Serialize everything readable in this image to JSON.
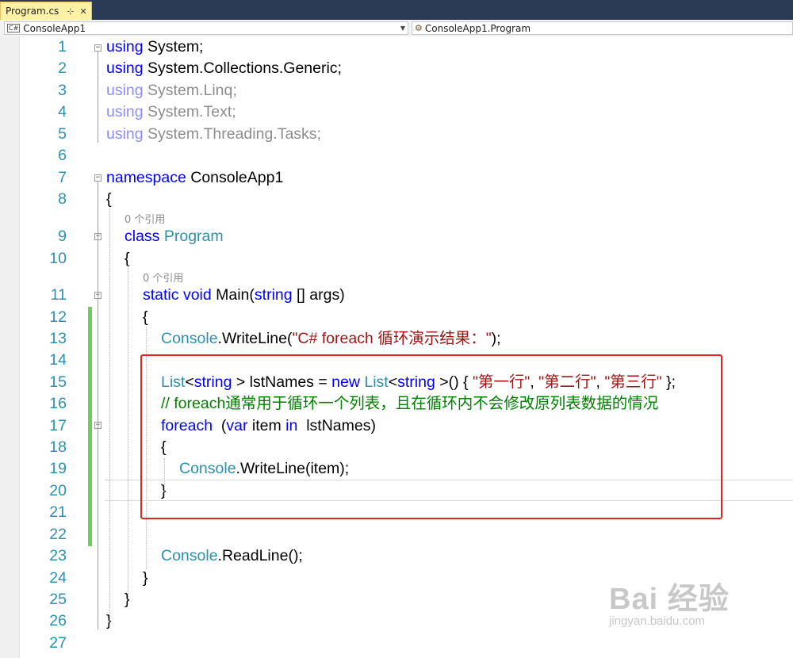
{
  "tab": {
    "title": "Program.cs",
    "pin_glyph": "⊹",
    "close_glyph": "✕"
  },
  "nav": {
    "project": "ConsoleApp1",
    "member": "ConsoleApp1.Program"
  },
  "refs": {
    "class_refs": "0 个引用",
    "method_refs": "0 个引用"
  },
  "lines": [
    {
      "n": "1",
      "segs": [
        [
          "kw",
          "using"
        ],
        [
          "",
          "System;"
        ]
      ]
    },
    {
      "n": "2",
      "segs": [
        [
          "kw",
          "using"
        ],
        [
          "",
          "System.Collections.Generic;"
        ]
      ]
    },
    {
      "n": "3",
      "dim": true,
      "segs": [
        [
          "kw",
          "using"
        ],
        [
          "",
          "System.Linq;"
        ]
      ]
    },
    {
      "n": "4",
      "dim": true,
      "segs": [
        [
          "kw",
          "using"
        ],
        [
          "",
          "System.Text;"
        ]
      ]
    },
    {
      "n": "5",
      "dim": true,
      "segs": [
        [
          "kw",
          "using"
        ],
        [
          "",
          "System.Threading.Tasks;"
        ]
      ]
    },
    {
      "n": "6",
      "segs": []
    },
    {
      "n": "7",
      "segs": [
        [
          "kw",
          "namespace"
        ],
        [
          "",
          "ConsoleApp1"
        ]
      ]
    },
    {
      "n": "8",
      "segs": [
        [
          "",
          "{"
        ]
      ]
    },
    {
      "n": "9",
      "segs": [
        [
          "kw",
          "class"
        ],
        [
          "ty",
          "Program"
        ]
      ]
    },
    {
      "n": "10",
      "segs": [
        [
          "",
          "{"
        ]
      ]
    },
    {
      "n": "11",
      "segs": [
        [
          "kw",
          "static"
        ],
        [
          "kw",
          "void"
        ],
        [
          "",
          "Main("
        ],
        [
          "kw",
          "string"
        ],
        [
          "",
          "[] args)"
        ]
      ]
    },
    {
      "n": "12",
      "segs": [
        [
          "",
          "{"
        ]
      ]
    },
    {
      "n": "13",
      "segs": [
        [
          "ty",
          "Console"
        ],
        [
          "",
          ".WriteLine("
        ],
        [
          "str",
          "\"C# foreach 循环演示结果：\""
        ],
        [
          "",
          ");"
        ]
      ]
    },
    {
      "n": "14",
      "segs": []
    },
    {
      "n": "15",
      "segs": [
        [
          "ty",
          "List"
        ],
        [
          "",
          "<"
        ],
        [
          "kw",
          "string"
        ],
        [
          "",
          "> lstNames = "
        ],
        [
          "kw",
          "new"
        ],
        [
          "ty",
          "List"
        ],
        [
          "",
          "<"
        ],
        [
          "kw",
          "string"
        ],
        [
          "",
          ">() { "
        ],
        [
          "str",
          "\"第一行\""
        ],
        [
          "",
          ", "
        ],
        [
          "str",
          "\"第二行\""
        ],
        [
          "",
          ", "
        ],
        [
          "str",
          "\"第三行\""
        ],
        [
          "",
          " };"
        ]
      ]
    },
    {
      "n": "16",
      "segs": [
        [
          "cm",
          "// foreach通常用于循环一个列表，且在循环内不会修改原列表数据的情况"
        ]
      ]
    },
    {
      "n": "17",
      "segs": [
        [
          "kw",
          "foreach"
        ],
        [
          "",
          " ("
        ],
        [
          "kw",
          "var"
        ],
        [
          "",
          "",
          " "
        ],
        [
          "",
          "item "
        ],
        [
          "kw",
          "in"
        ],
        [
          "",
          " lstNames)"
        ]
      ]
    },
    {
      "n": "18",
      "segs": [
        [
          "",
          "{"
        ]
      ]
    },
    {
      "n": "19",
      "segs": [
        [
          "ty",
          "Console"
        ],
        [
          "",
          ".WriteLine(item);"
        ]
      ]
    },
    {
      "n": "20",
      "segs": [
        [
          "",
          "}"
        ]
      ]
    },
    {
      "n": "21",
      "segs": []
    },
    {
      "n": "22",
      "segs": []
    },
    {
      "n": "23",
      "segs": [
        [
          "ty",
          "Console"
        ],
        [
          "",
          ".ReadLine();"
        ]
      ]
    },
    {
      "n": "24",
      "segs": [
        [
          "",
          "}"
        ]
      ]
    },
    {
      "n": "25",
      "segs": [
        [
          "",
          "}"
        ]
      ]
    },
    {
      "n": "26",
      "segs": [
        [
          "",
          "}"
        ]
      ]
    },
    {
      "n": "27",
      "segs": []
    }
  ],
  "watermark": {
    "brand": "Bai 经验",
    "site": "jingyan.baidu.com"
  }
}
